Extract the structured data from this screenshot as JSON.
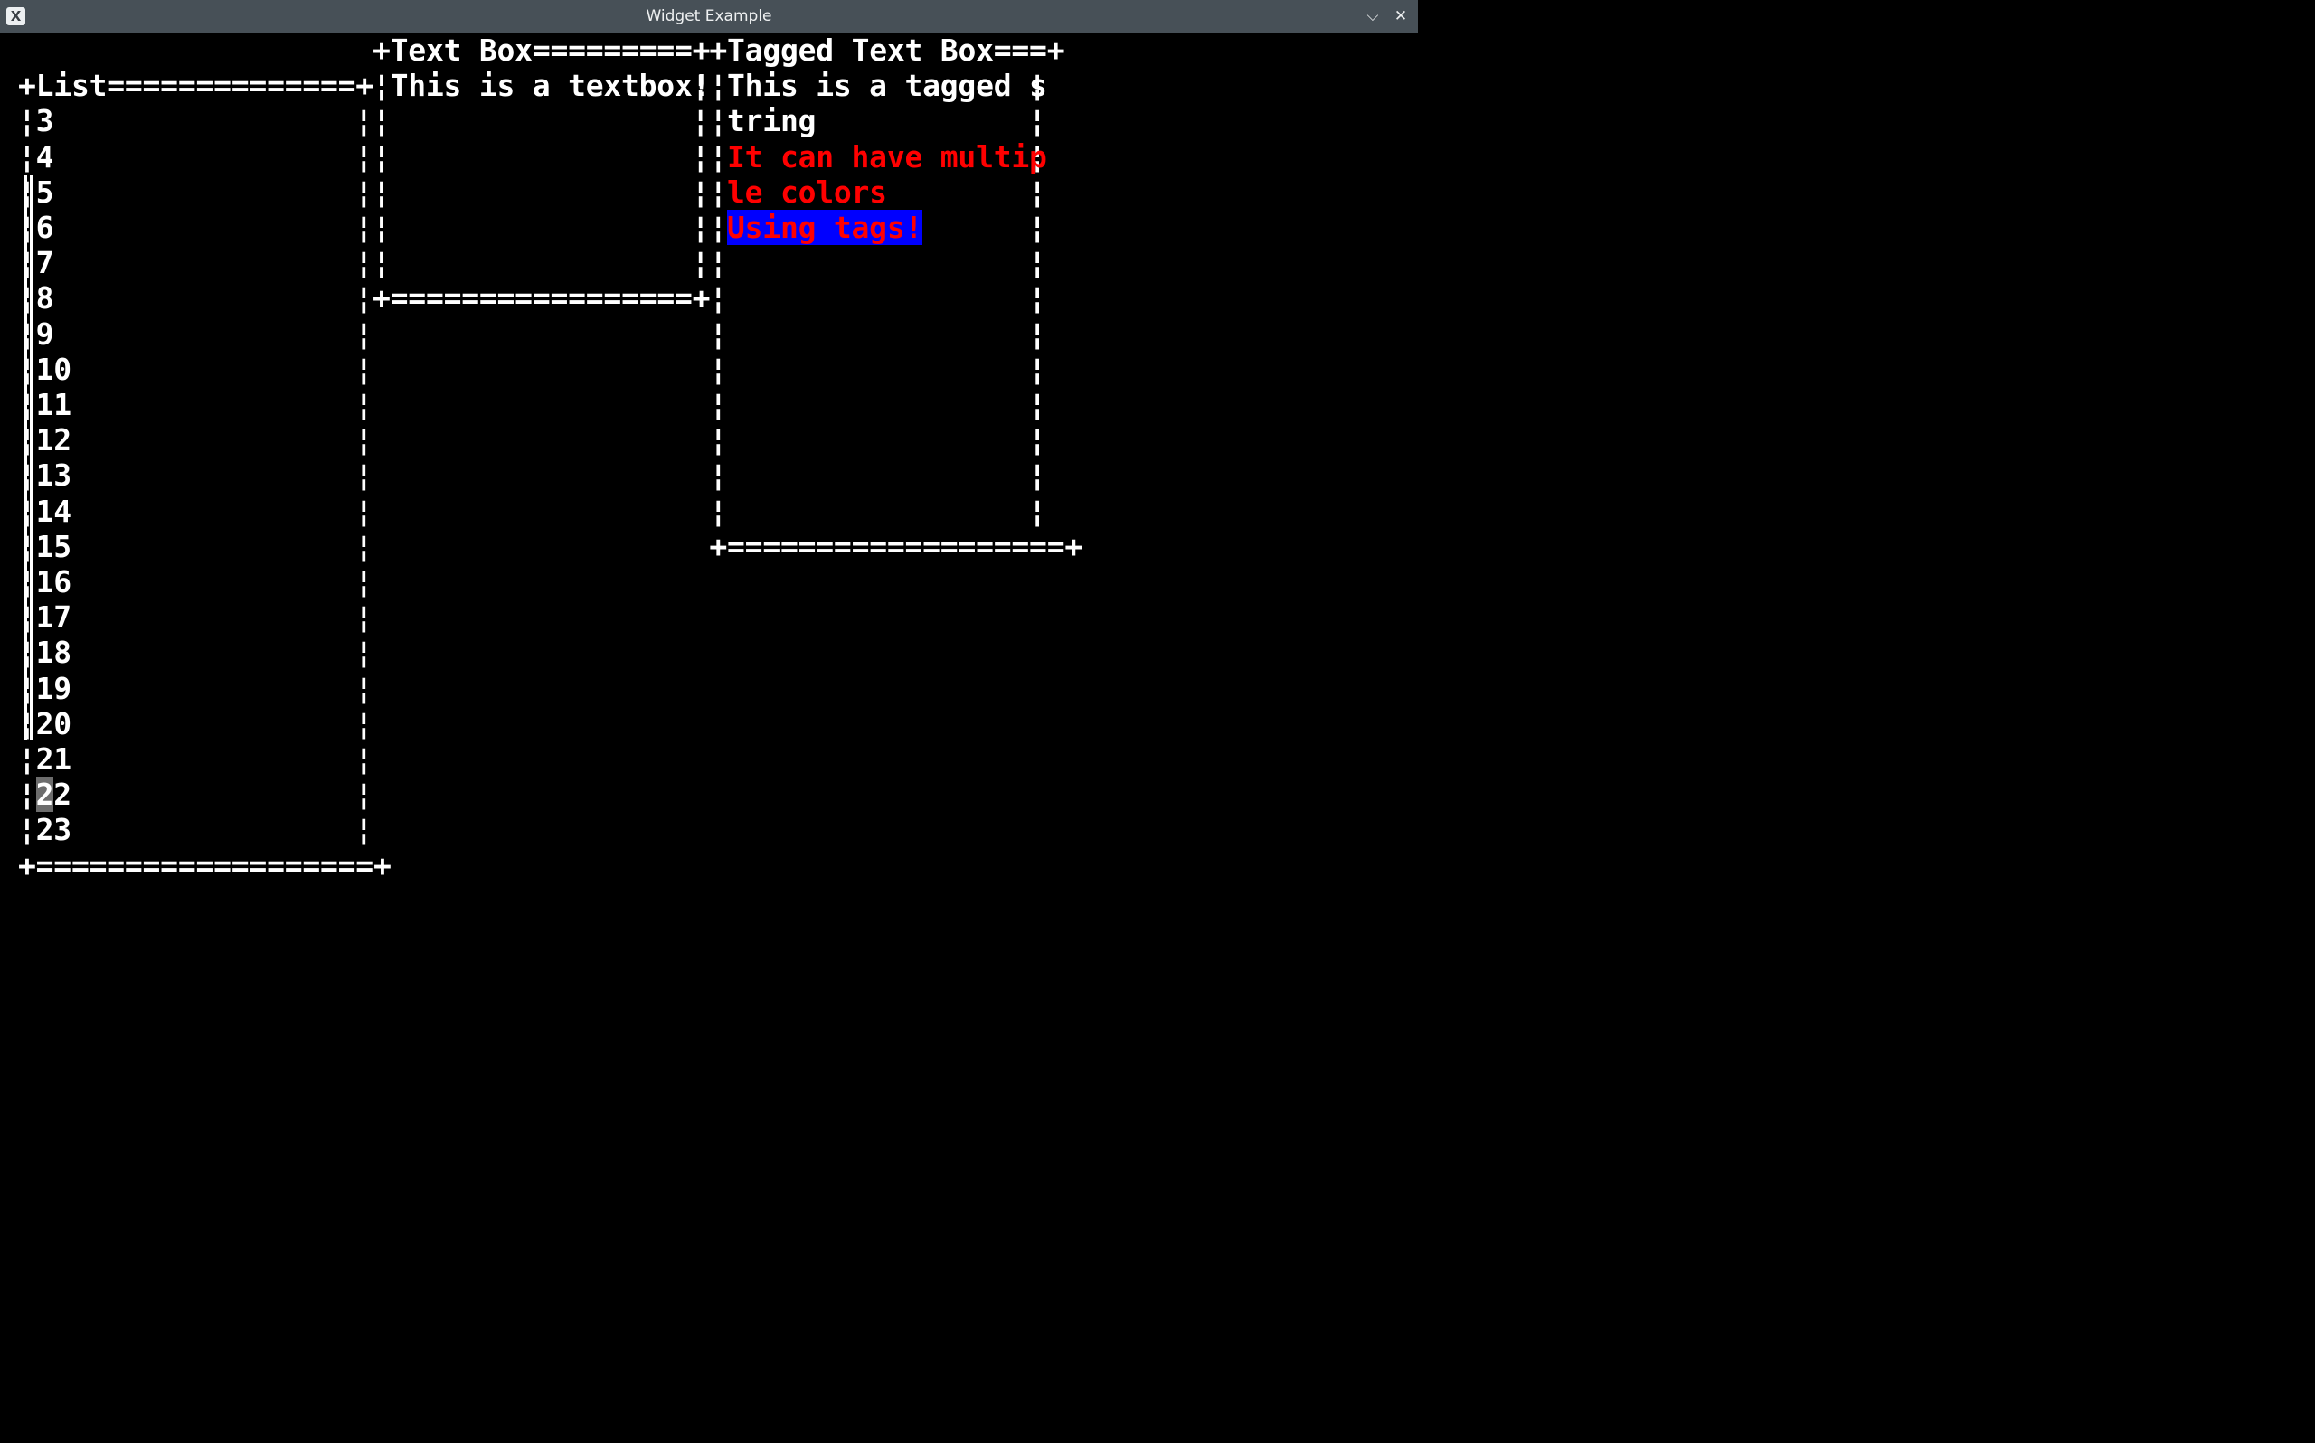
{
  "window": {
    "title": "Widget Example",
    "icon": "x-app-icon",
    "icon_glyph": "X",
    "minimize_glyph": "⌵",
    "close_glyph": "✕"
  },
  "list_box": {
    "title": "List",
    "items": [
      "3",
      "4",
      "5",
      "6",
      "7",
      "8",
      "9",
      "10",
      "11",
      "12",
      "13",
      "14",
      "15",
      "16",
      "17",
      "18",
      "19",
      "20",
      "21",
      "22",
      "23"
    ],
    "selected_item": "22"
  },
  "text_box": {
    "title": "Text Box",
    "text": "This is a textbox!"
  },
  "tagged_text_box": {
    "title": "Tagged Text Box",
    "lines": [
      {
        "text": "This is a tagged s",
        "style": "default"
      },
      {
        "text": "tring",
        "style": "default"
      },
      {
        "text": "It can have multip",
        "style": "red"
      },
      {
        "text": "le colors",
        "style": "red"
      },
      {
        "text": "Using tags!",
        "style": "red-on-blue"
      }
    ]
  },
  "colors": {
    "background": "#000000",
    "foreground": "#ffffff",
    "titlebar": "#475057",
    "tag_red": "#ff0000",
    "tag_blue": "#0000ff"
  },
  "frames": {
    "list_top": "+List==============+",
    "list_bottom": "+===================+",
    "text_top": "+Text Box=========+",
    "text_bottom": "+=================+",
    "tagged_top": "+Tagged Text Box===+",
    "tagged_bottom": "+===================+"
  }
}
